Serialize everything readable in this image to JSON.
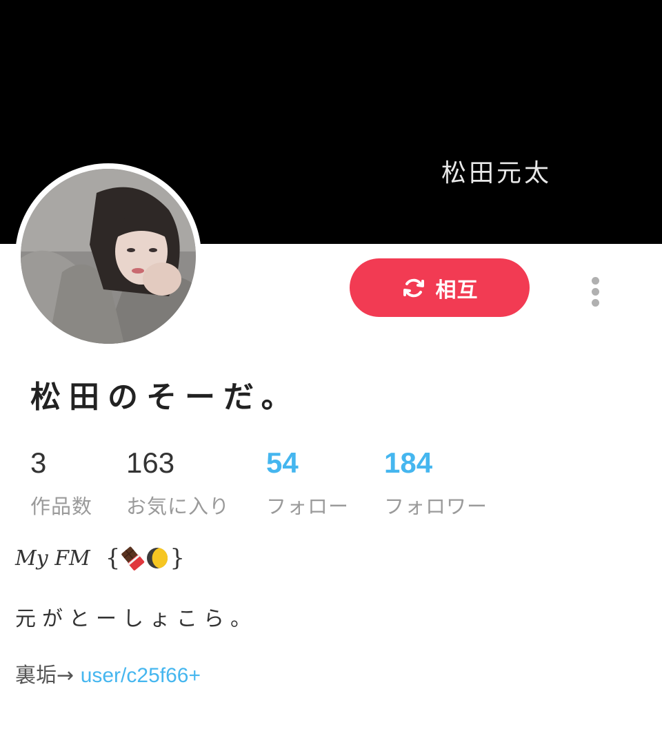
{
  "header": {
    "banner_text": "松田元太"
  },
  "profile": {
    "display_name": "松田のそーだ。",
    "mutual_button_label": "相互"
  },
  "stats": [
    {
      "value": "3",
      "label": "作品数"
    },
    {
      "value": "163",
      "label": "お気に入り"
    },
    {
      "value": "54",
      "label": "フォロー"
    },
    {
      "value": "184",
      "label": "フォロワー"
    }
  ],
  "bio": {
    "line1_text": "My FM",
    "line1_open": "{",
    "line1_close": "}",
    "line2": "元がとーしょこら。",
    "line3_prefix": "裏垢→ ",
    "line3_link": "user/c25f66+"
  },
  "colors": {
    "banner": "#000000",
    "mutual_button": "#f23b53",
    "accent_blue": "#45b6ef",
    "muted_text": "#9a9a9a"
  },
  "icons": {
    "mutual": "sync-icon",
    "menu": "more-vertical-icon",
    "emoji1": "chocolate-bar-icon",
    "emoji2": "crescent-moon-icon"
  }
}
